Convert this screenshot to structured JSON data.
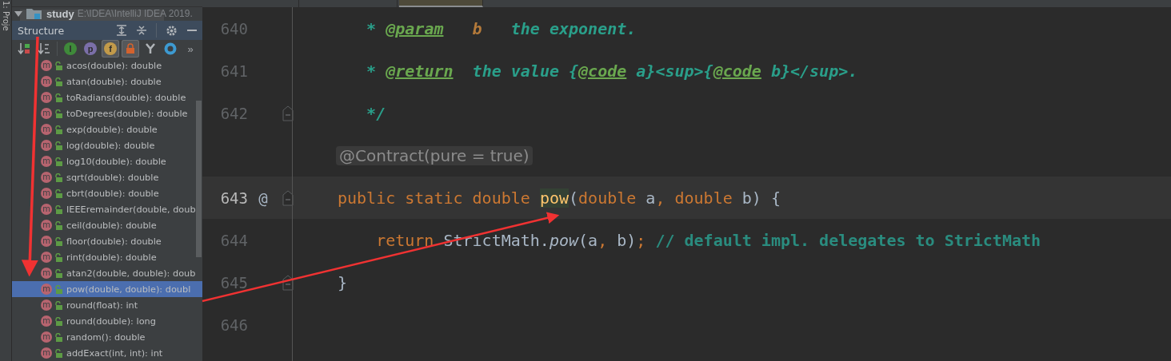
{
  "tabs": [
    {
      "selected": false
    },
    {
      "selected": false
    },
    {
      "selected": true
    }
  ],
  "side_stripe": {
    "label": "1: Proje"
  },
  "project_row": {
    "name": "study",
    "path": "E:\\IDEA\\IntelliJ IDEA 2019."
  },
  "structure": {
    "title": "Structure",
    "toolbar": [
      {
        "kind": "sort-visibility",
        "selected": false
      },
      {
        "kind": "sort-alpha",
        "selected": false
      },
      {
        "kind": "divider"
      },
      {
        "kind": "letter",
        "glyph": "I",
        "color": "#3f8a3a",
        "selected": false
      },
      {
        "kind": "letter",
        "glyph": "p",
        "color": "#7b6fa8",
        "selected": false
      },
      {
        "kind": "letter",
        "glyph": "f",
        "color": "#c29a4a",
        "selected": true
      },
      {
        "kind": "lock",
        "selected": true
      },
      {
        "kind": "fork",
        "selected": false
      },
      {
        "kind": "ring",
        "selected": false
      },
      {
        "kind": "more",
        "glyph": "»",
        "selected": false
      }
    ],
    "items": [
      {
        "icon": "m",
        "label": "acos(double): double",
        "selected": false
      },
      {
        "icon": "m",
        "label": "atan(double): double",
        "selected": false
      },
      {
        "icon": "m",
        "label": "toRadians(double): double",
        "selected": false
      },
      {
        "icon": "m",
        "label": "toDegrees(double): double",
        "selected": false
      },
      {
        "icon": "m",
        "label": "exp(double): double",
        "selected": false
      },
      {
        "icon": "m",
        "label": "log(double): double",
        "selected": false
      },
      {
        "icon": "m",
        "label": "log10(double): double",
        "selected": false
      },
      {
        "icon": "m",
        "label": "sqrt(double): double",
        "selected": false
      },
      {
        "icon": "m",
        "label": "cbrt(double): double",
        "selected": false
      },
      {
        "icon": "m",
        "label": "IEEEremainder(double, doub",
        "selected": false
      },
      {
        "icon": "m",
        "label": "ceil(double): double",
        "selected": false
      },
      {
        "icon": "m",
        "label": "floor(double): double",
        "selected": false
      },
      {
        "icon": "m",
        "label": "rint(double): double",
        "selected": false
      },
      {
        "icon": "m",
        "label": "atan2(double, double): doub",
        "selected": false
      },
      {
        "icon": "m",
        "label": "pow(double, double): doubl",
        "selected": true
      },
      {
        "icon": "m",
        "label": "round(float): int",
        "selected": false
      },
      {
        "icon": "m",
        "label": "round(double): long",
        "selected": false
      },
      {
        "icon": "m",
        "label": "random(): double",
        "selected": false
      },
      {
        "icon": "m",
        "label": "addExact(int, int): int",
        "selected": false
      }
    ]
  },
  "editor": {
    "lines": [
      {
        "kind": "code",
        "number": "640",
        "fold": false,
        "current": false,
        "tokens": [
          {
            "kind": "doc",
            "text": "   * "
          },
          {
            "kind": "tag",
            "text": "@param"
          },
          {
            "kind": "docparam",
            "text": "   b"
          },
          {
            "kind": "doc",
            "text": "   the exponent."
          }
        ]
      },
      {
        "kind": "code",
        "number": "641",
        "fold": false,
        "current": false,
        "tokens": [
          {
            "kind": "doc",
            "text": "   * "
          },
          {
            "kind": "tag",
            "text": "@return"
          },
          {
            "kind": "doc",
            "text": "  the value {"
          },
          {
            "kind": "tag",
            "text": "@code"
          },
          {
            "kind": "doc",
            "text": " a}<sup>{"
          },
          {
            "kind": "tag",
            "text": "@code"
          },
          {
            "kind": "doc",
            "text": " b}</sup>."
          }
        ]
      },
      {
        "kind": "code",
        "number": "642",
        "fold": true,
        "current": false,
        "tokens": [
          {
            "kind": "doc",
            "text": "   */"
          }
        ]
      },
      {
        "kind": "inlay",
        "text": "@Contract(pure = true)"
      },
      {
        "kind": "code",
        "number": "643",
        "marker": "@",
        "fold": true,
        "current": true,
        "tokens": [
          {
            "kind": "keyword",
            "text": "public static double "
          },
          {
            "kind": "match",
            "text": "pow"
          },
          {
            "kind": "plain",
            "text": "("
          },
          {
            "kind": "keyword",
            "text": "double"
          },
          {
            "kind": "plain",
            "text": " a"
          },
          {
            "kind": "keyword",
            "text": ", double"
          },
          {
            "kind": "plain",
            "text": " b) {"
          }
        ]
      },
      {
        "kind": "code",
        "number": "644",
        "fold": false,
        "current": false,
        "tokens": [
          {
            "kind": "keyword",
            "text": "    return "
          },
          {
            "kind": "plain",
            "text": "StrictMath."
          },
          {
            "kind": "call",
            "text": "pow"
          },
          {
            "kind": "plain",
            "text": "(a"
          },
          {
            "kind": "keyword",
            "text": ", "
          },
          {
            "kind": "plain",
            "text": "b)"
          },
          {
            "kind": "keyword",
            "text": "; "
          },
          {
            "kind": "comment",
            "text": "// default impl. delegates to StrictMath"
          }
        ]
      },
      {
        "kind": "code",
        "number": "645",
        "fold": true,
        "current": false,
        "tokens": [
          {
            "kind": "plain",
            "text": "}"
          }
        ]
      },
      {
        "kind": "code",
        "number": "646",
        "fold": false,
        "current": false
      }
    ]
  }
}
